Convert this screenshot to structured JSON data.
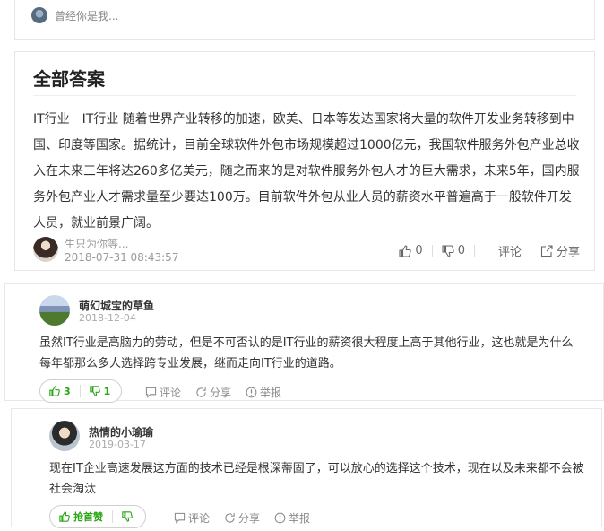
{
  "top_card": {
    "user_name": "曾经你是我..."
  },
  "answer_section": {
    "title": "全部答案",
    "content": "IT行业　IT行业 随着世界产业转移的加速，欧美、日本等发达国家将大量的软件开发业务转移到中国、印度等国家。据统计，目前全球软件外包市场规模超过1000亿元，我国软件服务外包产业总收入在未来三年将达260多亿美元，随之而来的是对软件服务外包人才的巨大需求，未来5年，国内服务外包产业人才需求量至少要达100万。目前软件外包从业人员的薪资水平普遍高于一般软件开发人员，就业前景广阔。",
    "author": "生只为你等...",
    "date": "2018-07-31 08:43:57",
    "like_count": "0",
    "dislike_count": "0",
    "comment_label": "评论",
    "share_label": "分享"
  },
  "comments": [
    {
      "name": "萌幻城宝的草鱼",
      "date": "2018-12-04",
      "text": "虽然IT行业是高脑力的劳动，但是不可否认的是IT行业的薪资很大程度上高于其他行业，这也就是为什么每年都那么多人选择跨专业发展，继而走向IT行业的道路。",
      "likes": "3",
      "dislikes": "1",
      "comment_label": "评论",
      "share_label": "分享",
      "report_label": "举报"
    },
    {
      "name": "热情的小瑜瑜",
      "date": "2019-03-17",
      "text": "现在IT企业高速发展这方面的技术已经是根深蒂固了，可以放心的选择这个技术，现在以及未来都不会被社会淘汰",
      "first_like_label": "抢首赞",
      "comment_label": "评论",
      "share_label": "分享",
      "report_label": "举报"
    }
  ],
  "colors": {
    "accent_green": "#2aa515",
    "text": "#333333",
    "muted": "#999999"
  }
}
